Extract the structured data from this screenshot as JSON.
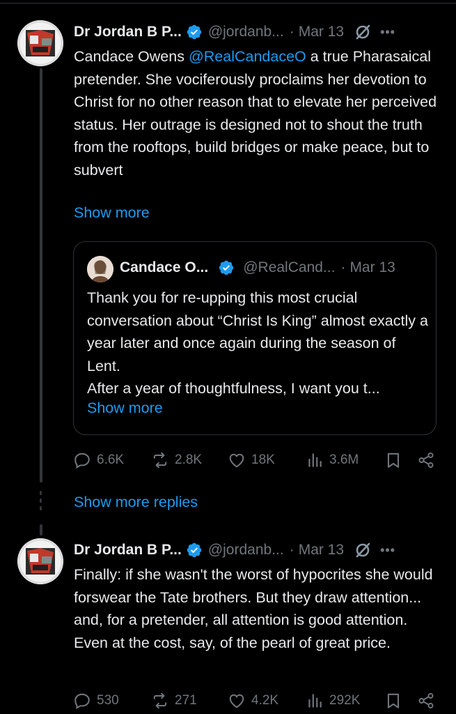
{
  "tweets": [
    {
      "name": "Dr Jordan B P...",
      "handle": "@jordanb...",
      "separator": "·",
      "date": "Mar 13",
      "text_before": "Candace Owens ",
      "mention": "@RealCandaceO",
      "text_after": " a true Pharasaical pretender. She vociferously proclaims her devotion to Christ for no other reason that to elevate her perceived status. Her outrage is designed not to shout the truth from the rooftops, build bridges or make peace, but to subvert",
      "show_more": "Show more",
      "quote": {
        "name": "Candace O...",
        "handle": "@RealCand...",
        "separator": "·",
        "date": "Mar 13",
        "text_line1": "Thank you for re-upping this most crucial conversation about “Christ Is King” almost exactly a year later and once again during the season of Lent.",
        "text_line2": "After a year of thoughtfulness, I want you t...",
        "show_more": "Show more"
      },
      "stats": {
        "replies": "6.6K",
        "reposts": "2.8K",
        "likes": "18K",
        "views": "3.6M"
      }
    },
    {
      "name": "Dr Jordan B P...",
      "handle": "@jordanb...",
      "separator": "·",
      "date": "Mar 13",
      "text": "Finally: if she wasn't the worst of hypocrites she would forswear the Tate brothers. But they draw attention... and, for a pretender, all attention is good attention. Even at the cost, say, of the pearl of great price.",
      "stats": {
        "replies": "530",
        "reposts": "271",
        "likes": "4.2K",
        "views": "292K"
      }
    }
  ],
  "show_more_replies": "Show more replies",
  "icons": {
    "verified": "verified-badge-icon",
    "grok": "grok-icon",
    "more": "more-options-icon",
    "reply": "reply-icon",
    "repost": "repost-icon",
    "like": "like-icon",
    "views": "views-icon",
    "bookmark": "bookmark-icon",
    "share": "share-icon"
  },
  "colors": {
    "background": "#000000",
    "text": "#e7e9ea",
    "muted": "#71767b",
    "accent": "#1d9bf0",
    "border": "#2f3336"
  }
}
